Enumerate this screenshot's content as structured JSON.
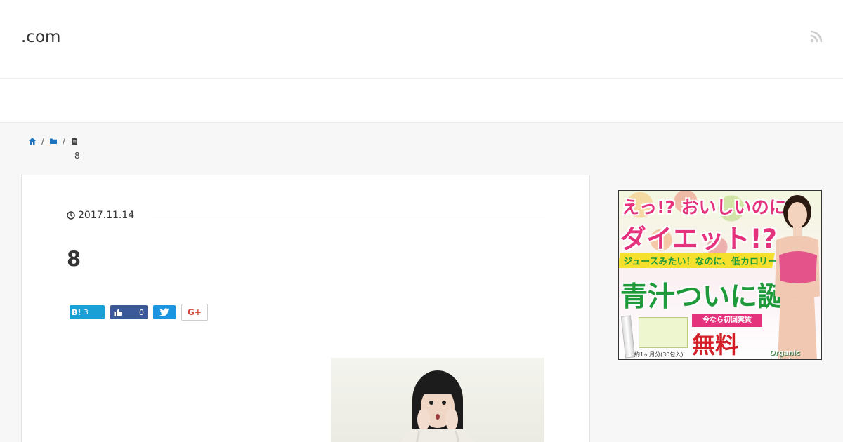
{
  "header": {
    "site_title": ".com",
    "rss_icon": "rss-icon"
  },
  "breadcrumb": {
    "home_icon": "home-icon",
    "folder_icon": "folder-icon",
    "file_icon": "file-icon",
    "separator": "/",
    "current": "8"
  },
  "post": {
    "date": "2017.11.14",
    "date_icon": "clock-icon",
    "title": "8"
  },
  "share": {
    "hatena_label": "B!",
    "hatena_count": "3",
    "like_count": "0",
    "google_label": "G+"
  },
  "ad": {
    "line1": "えっ!? おいしいのに",
    "line2": "ダイエット!?",
    "line3": "ジュースみたい！なのに、低カロリー",
    "line4": "青汁ついに誕生",
    "tag": "今なら初回実質",
    "free": "無料",
    "sub": "約1ヶ月分(30包入)",
    "logo": "Organic Label"
  },
  "colors": {
    "link": "#1e73be",
    "facebook": "#3b5998",
    "twitter": "#1b95e0",
    "hatena": "#1ba0d6"
  }
}
